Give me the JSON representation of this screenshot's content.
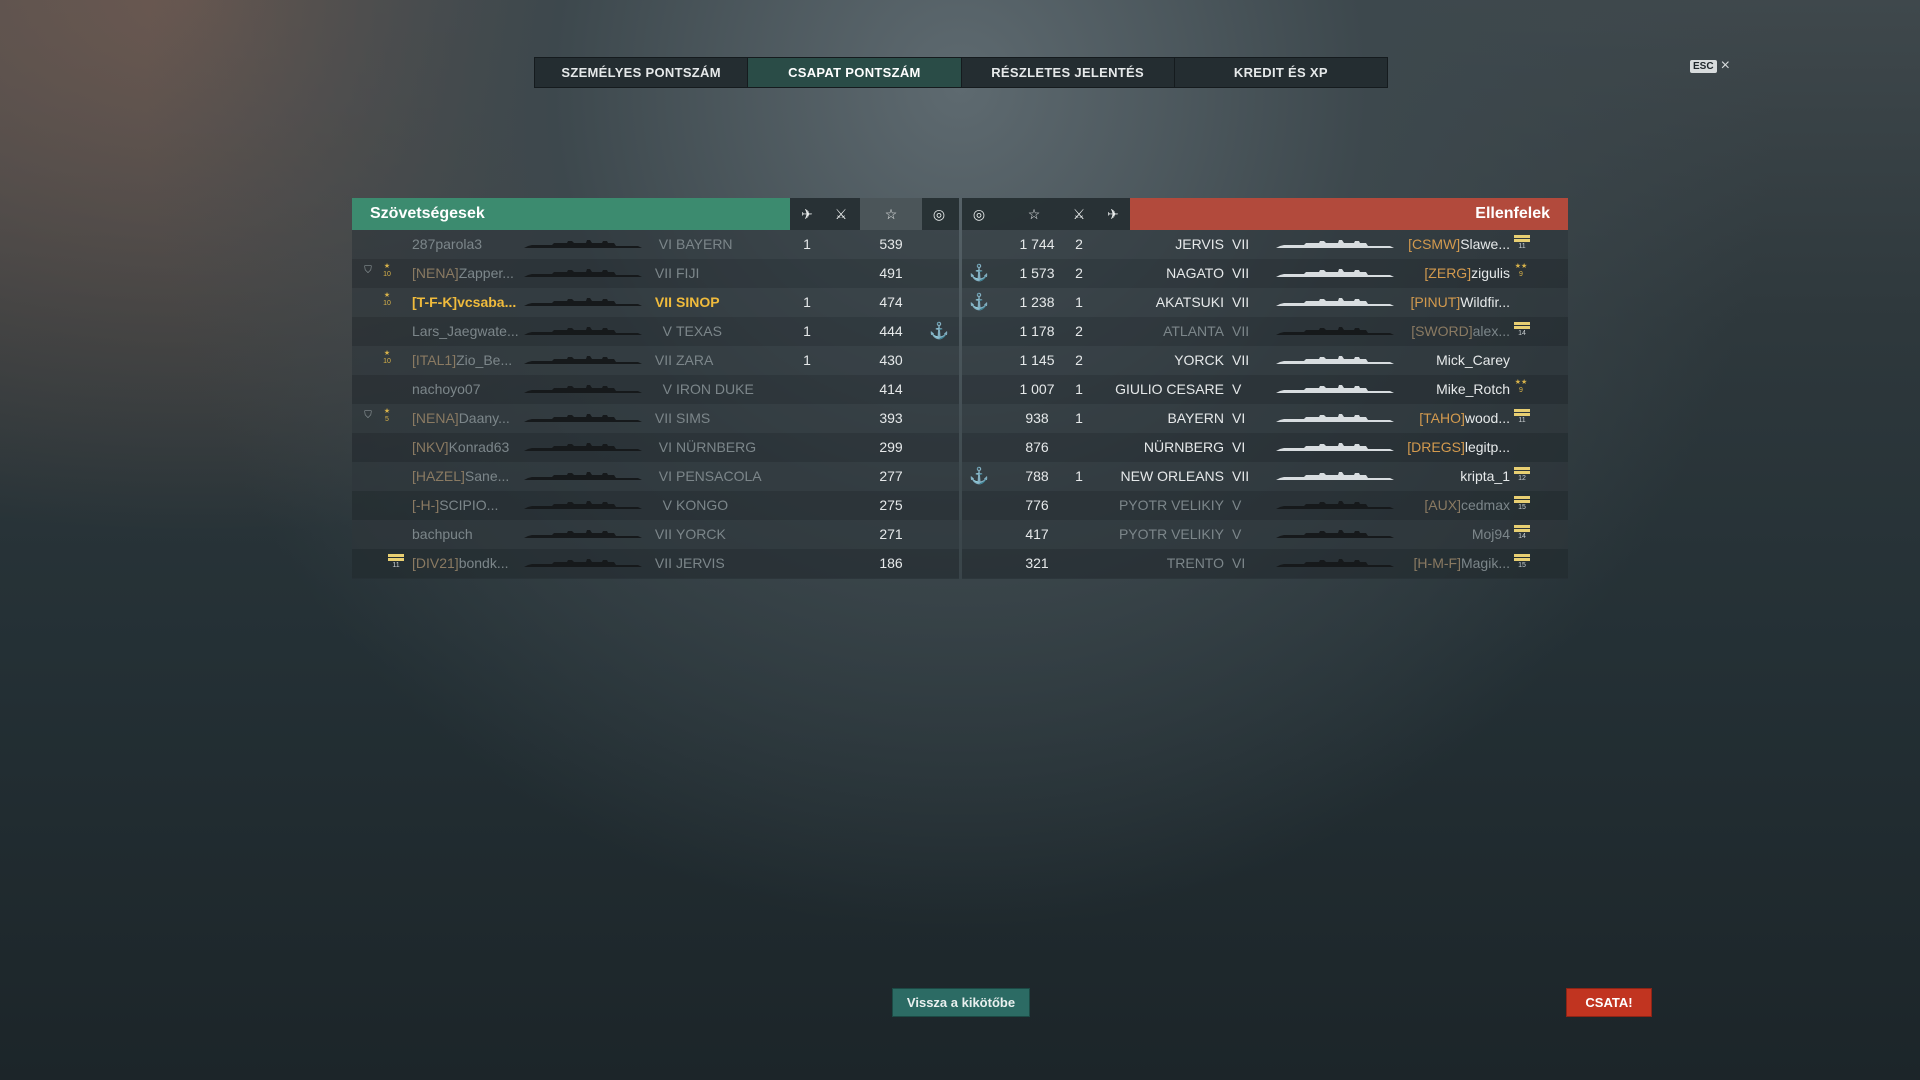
{
  "tabs": [
    {
      "label": "SZEMÉLYES PONTSZÁM",
      "active": false
    },
    {
      "label": "CSAPAT PONTSZÁM",
      "active": true
    },
    {
      "label": "RÉSZLETES JELENTÉS",
      "active": false
    },
    {
      "label": "KREDIT ÉS XP",
      "active": false
    }
  ],
  "esc": {
    "key": "ESC",
    "close": "×"
  },
  "allies": {
    "title": "Szövetségesek",
    "header_icons": [
      "plane-icon",
      "crossed-swords-icon",
      "star-icon",
      "base-capture-icon"
    ],
    "rows": [
      {
        "clan": "",
        "name": "287parola3",
        "tier": "VI",
        "ship": "BAYERN",
        "kills": "1",
        "score": "539",
        "dead": true,
        "player": false,
        "anchor": false,
        "division_star": "",
        "badge": false,
        "stripe": ""
      },
      {
        "clan": "[NENA]",
        "name": "Zapper...",
        "tier": "VII",
        "ship": "FIJI",
        "kills": "",
        "score": "491",
        "dead": true,
        "player": false,
        "anchor": false,
        "division_star": "10",
        "badge": true,
        "stripe": ""
      },
      {
        "clan": "[T-F-K]",
        "name": "vcsaba...",
        "tier": "VII",
        "ship": "SINOP",
        "kills": "1",
        "score": "474",
        "dead": false,
        "player": true,
        "anchor": false,
        "division_star": "10",
        "badge": false,
        "stripe": ""
      },
      {
        "clan": "",
        "name": "Lars_Jaegwate...",
        "tier": "V",
        "ship": "TEXAS",
        "kills": "1",
        "score": "444",
        "dead": true,
        "player": false,
        "anchor": true,
        "division_star": "",
        "badge": false,
        "stripe": ""
      },
      {
        "clan": "[ITAL1]",
        "name": "Zio_Be...",
        "tier": "VII",
        "ship": "ZARA",
        "kills": "1",
        "score": "430",
        "dead": true,
        "player": false,
        "anchor": false,
        "division_star": "10",
        "badge": false,
        "stripe": ""
      },
      {
        "clan": "",
        "name": "nachoyo07",
        "tier": "V",
        "ship": "IRON DUKE",
        "kills": "",
        "score": "414",
        "dead": true,
        "player": false,
        "anchor": false,
        "division_star": "",
        "badge": false,
        "stripe": ""
      },
      {
        "clan": "[NENA]",
        "name": "Daany...",
        "tier": "VII",
        "ship": "SIMS",
        "kills": "",
        "score": "393",
        "dead": true,
        "player": false,
        "anchor": false,
        "division_star": "5",
        "badge": true,
        "stripe": ""
      },
      {
        "clan": "[NKV]",
        "name": "Konrad63",
        "tier": "VI",
        "ship": "NÜRNBERG",
        "kills": "",
        "score": "299",
        "dead": true,
        "player": false,
        "anchor": false,
        "division_star": "",
        "badge": false,
        "stripe": ""
      },
      {
        "clan": "[HAZEL]",
        "name": "Sane...",
        "tier": "VI",
        "ship": "PENSACOLA",
        "kills": "",
        "score": "277",
        "dead": true,
        "player": false,
        "anchor": false,
        "division_star": "",
        "badge": false,
        "stripe": ""
      },
      {
        "clan": "[-H-]",
        "name": "SCIPIO...",
        "tier": "V",
        "ship": "KONGO",
        "kills": "",
        "score": "275",
        "dead": true,
        "player": false,
        "anchor": false,
        "division_star": "",
        "badge": false,
        "stripe": ""
      },
      {
        "clan": "",
        "name": "bachpuch",
        "tier": "VII",
        "ship": "YORCK",
        "kills": "",
        "score": "271",
        "dead": true,
        "player": false,
        "anchor": false,
        "division_star": "",
        "badge": false,
        "stripe": ""
      },
      {
        "clan": "[DIV21]",
        "name": "bondk...",
        "tier": "VII",
        "ship": "JERVIS",
        "kills": "",
        "score": "186",
        "dead": true,
        "player": false,
        "anchor": false,
        "division_star": "",
        "badge": false,
        "stripe": "11"
      }
    ]
  },
  "enemies": {
    "title": "Ellenfelek",
    "header_icons": [
      "base-capture-icon",
      "star-icon",
      "crossed-swords-icon",
      "plane-icon"
    ],
    "rows": [
      {
        "clan": "[CSMW]",
        "name": "Slawe...",
        "tier": "VII",
        "ship": "JERVIS",
        "kills": "2",
        "score": "1 744",
        "dead": false,
        "anchor": false,
        "division_star": "",
        "stripe": "11"
      },
      {
        "clan": "[ZERG]",
        "name": "zigulis",
        "tier": "VII",
        "ship": "NAGATO",
        "kills": "2",
        "score": "1 573",
        "dead": false,
        "anchor": true,
        "division_star": "9",
        "stripe": ""
      },
      {
        "clan": "[PINUT]",
        "name": "Wildfir...",
        "tier": "VII",
        "ship": "AKATSUKI",
        "kills": "1",
        "score": "1 238",
        "dead": false,
        "anchor": true,
        "division_star": "",
        "stripe": ""
      },
      {
        "clan": "[SWORD]",
        "name": "alex...",
        "tier": "VII",
        "ship": "ATLANTA",
        "kills": "2",
        "score": "1 178",
        "dead": true,
        "anchor": false,
        "division_star": "",
        "stripe": "14"
      },
      {
        "clan": "",
        "name": "Mick_Carey",
        "tier": "VII",
        "ship": "YORCK",
        "kills": "2",
        "score": "1 145",
        "dead": false,
        "anchor": false,
        "division_star": "",
        "stripe": ""
      },
      {
        "clan": "",
        "name": "Mike_Rotch",
        "tier": "V",
        "ship": "GIULIO CESARE",
        "kills": "1",
        "score": "1 007",
        "dead": false,
        "anchor": false,
        "division_star": "9",
        "stripe": ""
      },
      {
        "clan": "[TAHO]",
        "name": "wood...",
        "tier": "VI",
        "ship": "BAYERN",
        "kills": "1",
        "score": "938",
        "dead": false,
        "anchor": false,
        "division_star": "",
        "stripe": "11"
      },
      {
        "clan": "[DREGS]",
        "name": "legitp...",
        "tier": "VI",
        "ship": "NÜRNBERG",
        "kills": "",
        "score": "876",
        "dead": false,
        "anchor": false,
        "division_star": "",
        "stripe": ""
      },
      {
        "clan": "",
        "name": "kripta_1",
        "tier": "VII",
        "ship": "NEW ORLEANS",
        "kills": "1",
        "score": "788",
        "dead": false,
        "anchor": true,
        "division_star": "",
        "stripe": "12"
      },
      {
        "clan": "[AUX]",
        "name": "cedmax",
        "tier": "V",
        "ship": "PYOTR VELIKIY",
        "kills": "",
        "score": "776",
        "dead": true,
        "anchor": false,
        "division_star": "",
        "stripe": "15"
      },
      {
        "clan": "",
        "name": "Moj94",
        "tier": "V",
        "ship": "PYOTR VELIKIY",
        "kills": "",
        "score": "417",
        "dead": true,
        "anchor": false,
        "division_star": "",
        "stripe": "14"
      },
      {
        "clan": "[H-M-F]",
        "name": "Magik...",
        "tier": "VI",
        "ship": "TRENTO",
        "kills": "",
        "score": "321",
        "dead": true,
        "anchor": false,
        "division_star": "",
        "stripe": "15"
      }
    ]
  },
  "buttons": {
    "back_to_port": "Vissza a kikötőbe",
    "battle": "CSATA!"
  },
  "colors": {
    "ally": "#3c8b6f",
    "enemy": "#b24a3c",
    "player": "#f0bb3c",
    "battle_button": "#c13420"
  }
}
